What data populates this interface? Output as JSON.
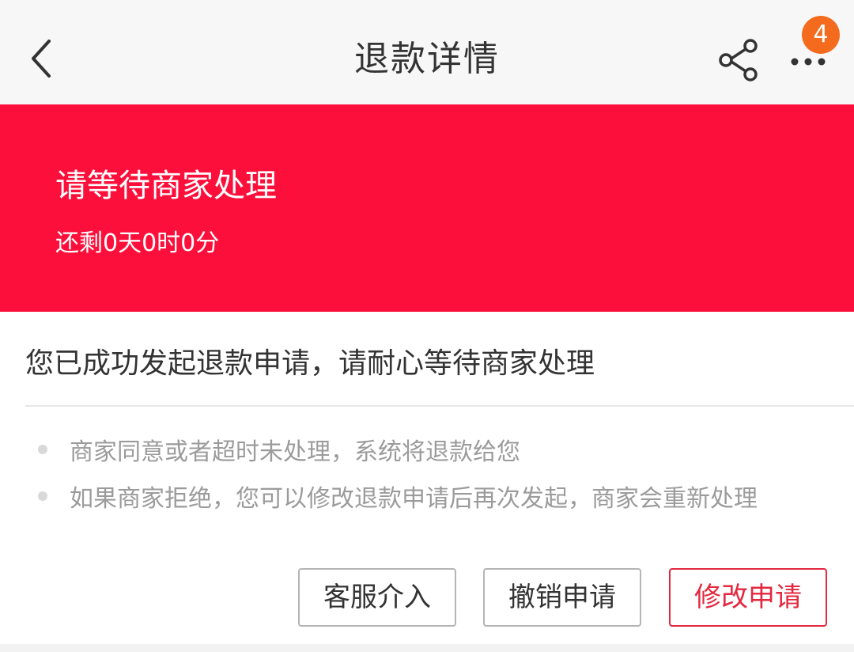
{
  "header": {
    "title": "退款详情",
    "badge_count": "4",
    "icons": {
      "back": "chevron-left-icon",
      "share": "share-icon",
      "more": "more-dots-icon"
    }
  },
  "banner": {
    "title": "请等待商家处理",
    "countdown": "还剩0天0时0分",
    "color": "#fc0f3a"
  },
  "detail": {
    "message": "您已成功发起退款申请，请耐心等待商家处理",
    "tips": [
      "商家同意或者超时未处理，系统将退款给您",
      "如果商家拒绝，您可以修改退款申请后再次发起，商家会重新处理"
    ]
  },
  "actions": {
    "customer_service": "客服介入",
    "cancel": "撤销申请",
    "modify": "修改申请"
  },
  "colors": {
    "accent": "#e3283f",
    "badge": "#f46b1e"
  }
}
